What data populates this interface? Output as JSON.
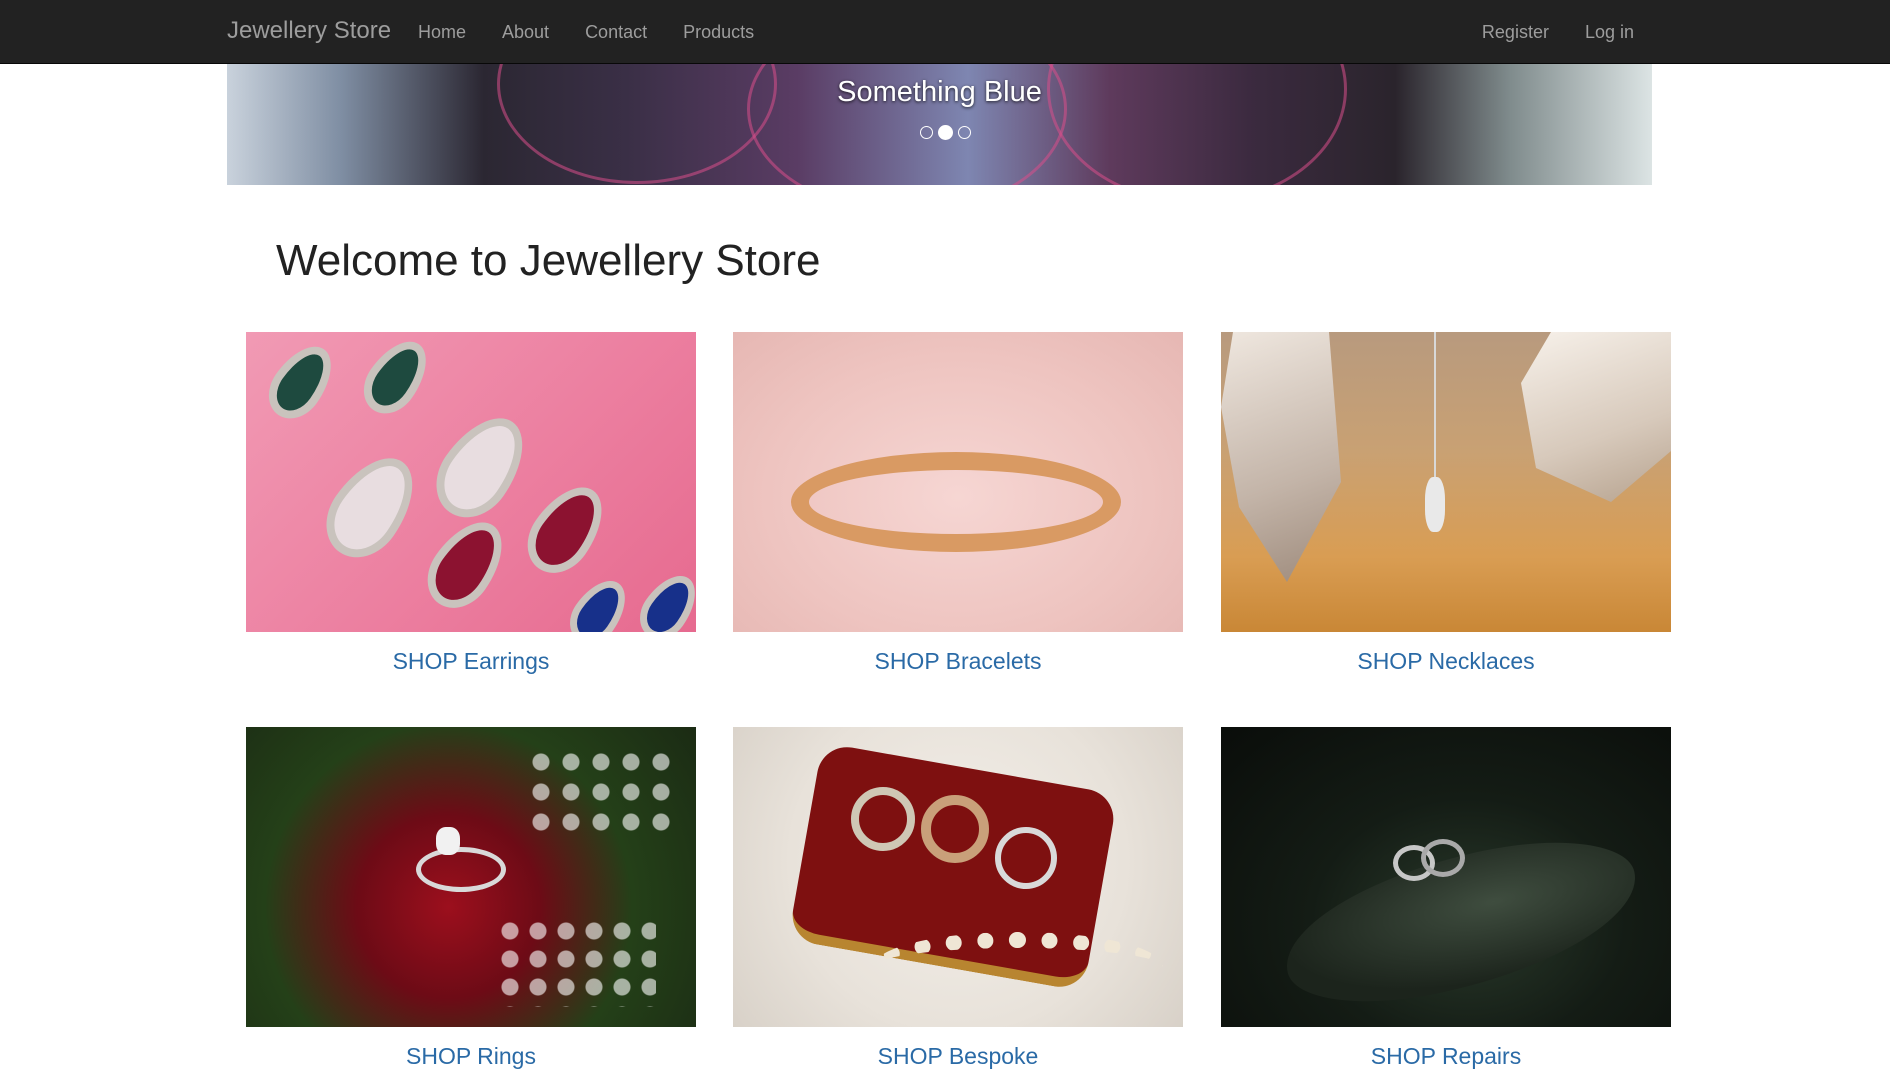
{
  "navbar": {
    "brand": "Jewellery Store",
    "left_links": [
      "Home",
      "About",
      "Contact",
      "Products"
    ],
    "right_links": [
      "Register",
      "Log in"
    ],
    "background": "#222222",
    "link_color": "#9d9d9d"
  },
  "carousel": {
    "caption": "Something Blue",
    "active_index": 1,
    "slide_count": 3
  },
  "main": {
    "heading": "Welcome to Jewellery Store",
    "link_color": "#2a6aa6",
    "categories": [
      {
        "label": "SHOP Earrings"
      },
      {
        "label": "SHOP Bracelets"
      },
      {
        "label": "SHOP Necklaces"
      },
      {
        "label": "SHOP Rings"
      },
      {
        "label": "SHOP Bespoke"
      },
      {
        "label": "SHOP Repairs"
      }
    ]
  }
}
